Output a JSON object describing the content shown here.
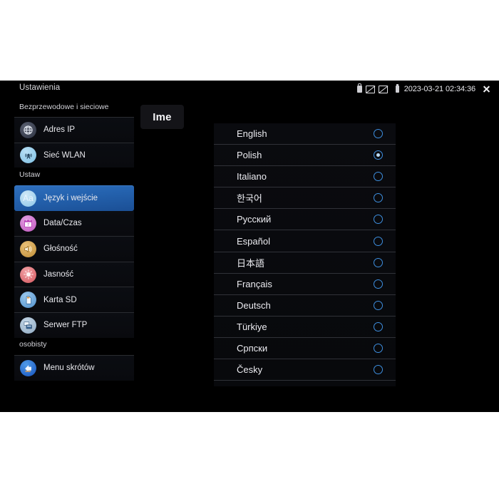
{
  "statusbar": {
    "app_title": "Ustawienia",
    "timestamp": "2023-03-21 02:34:36",
    "icons": [
      "lock-icon",
      "screen-disabled-icon",
      "screen-disabled-icon",
      "battery-icon",
      "close-icon"
    ]
  },
  "sidebar": {
    "groups": [
      {
        "label": "Bezprzewodowe i sieciowe"
      },
      {
        "label": "Ustaw"
      },
      {
        "label": "osobisty"
      }
    ],
    "items": [
      {
        "label": "Adres IP",
        "icon": "globe-icon",
        "active": false
      },
      {
        "label": "Sieć WLAN",
        "icon": "wifi-tower-icon",
        "active": false
      },
      {
        "label": "Język i wejście",
        "icon": "language-icon",
        "active": true
      },
      {
        "label": "Data/Czas",
        "icon": "calendar-icon",
        "active": false
      },
      {
        "label": "Głośność",
        "icon": "speaker-icon",
        "active": false
      },
      {
        "label": "Jasność",
        "icon": "brightness-icon",
        "active": false
      },
      {
        "label": "Karta SD",
        "icon": "sd-card-icon",
        "active": false
      },
      {
        "label": "Serwer FTP",
        "icon": "ftp-server-icon",
        "active": false
      },
      {
        "label": "Menu skrótów",
        "icon": "shortcut-icon",
        "active": false
      }
    ]
  },
  "main": {
    "tab_label": "Ime",
    "languages": [
      {
        "name": "English",
        "selected": false
      },
      {
        "name": "Polish",
        "selected": true
      },
      {
        "name": "Italiano",
        "selected": false
      },
      {
        "name": "한국어",
        "selected": false
      },
      {
        "name": "Русский",
        "selected": false
      },
      {
        "name": "Español",
        "selected": false
      },
      {
        "name": "日本語",
        "selected": false
      },
      {
        "name": "Français",
        "selected": false
      },
      {
        "name": "Deutsch",
        "selected": false
      },
      {
        "name": "Türkiye",
        "selected": false
      },
      {
        "name": "Српски",
        "selected": false
      },
      {
        "name": "Česky",
        "selected": false
      }
    ]
  },
  "colors": {
    "accent": "#3e8fe0",
    "selected_row": "#2462ae",
    "background": "#000000",
    "text": "#ececf1"
  }
}
